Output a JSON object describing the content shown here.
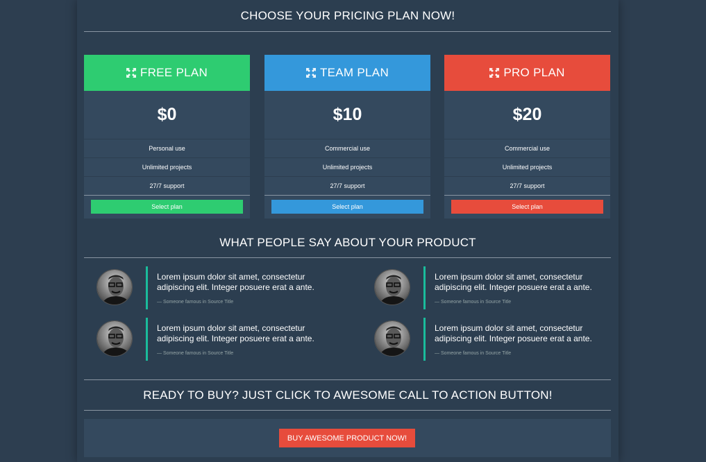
{
  "pricing": {
    "title": "CHOOSE YOUR PRICING PLAN NOW!",
    "plans": [
      {
        "name": "FREE PLAN",
        "price": "$0",
        "color": "#2ecc71",
        "features": [
          "Personal use",
          "Unlimited projects",
          "27/7 support"
        ],
        "button": "Select plan"
      },
      {
        "name": "TEAM PLAN",
        "price": "$10",
        "color": "#3498db",
        "features": [
          "Commercial use",
          "Unlimited projects",
          "27/7 support"
        ],
        "button": "Select plan"
      },
      {
        "name": "PRO PLAN",
        "price": "$20",
        "color": "#e74c3c",
        "features": [
          "Commercial use",
          "Unlimited projects",
          "27/7 support"
        ],
        "button": "Select plan"
      }
    ],
    "icon": "expand-arrows-icon"
  },
  "testimonials": {
    "title": "WHAT PEOPLE SAY ABOUT YOUR PRODUCT",
    "items": [
      {
        "text": "Lorem ipsum dolor sit amet, consectetur adipiscing elit. Integer posuere erat a ante.",
        "source": "— Someone famous in Source Title"
      },
      {
        "text": "Lorem ipsum dolor sit amet, consectetur adipiscing elit. Integer posuere erat a ante.",
        "source": "— Someone famous in Source Title"
      },
      {
        "text": "Lorem ipsum dolor sit amet, consectetur adipiscing elit. Integer posuere erat a ante.",
        "source": "— Someone famous in Source Title"
      },
      {
        "text": "Lorem ipsum dolor sit amet, consectetur adipiscing elit. Integer posuere erat a ante.",
        "source": "— Someone famous in Source Title"
      }
    ],
    "accent": "#1abc9c"
  },
  "cta": {
    "title": "READY TO BUY? JUST CLICK TO AWESOME CALL TO ACTION BUTTON!",
    "button": "BUY AWESOME PRODUCT NOW!",
    "color": "#e74c3c"
  }
}
